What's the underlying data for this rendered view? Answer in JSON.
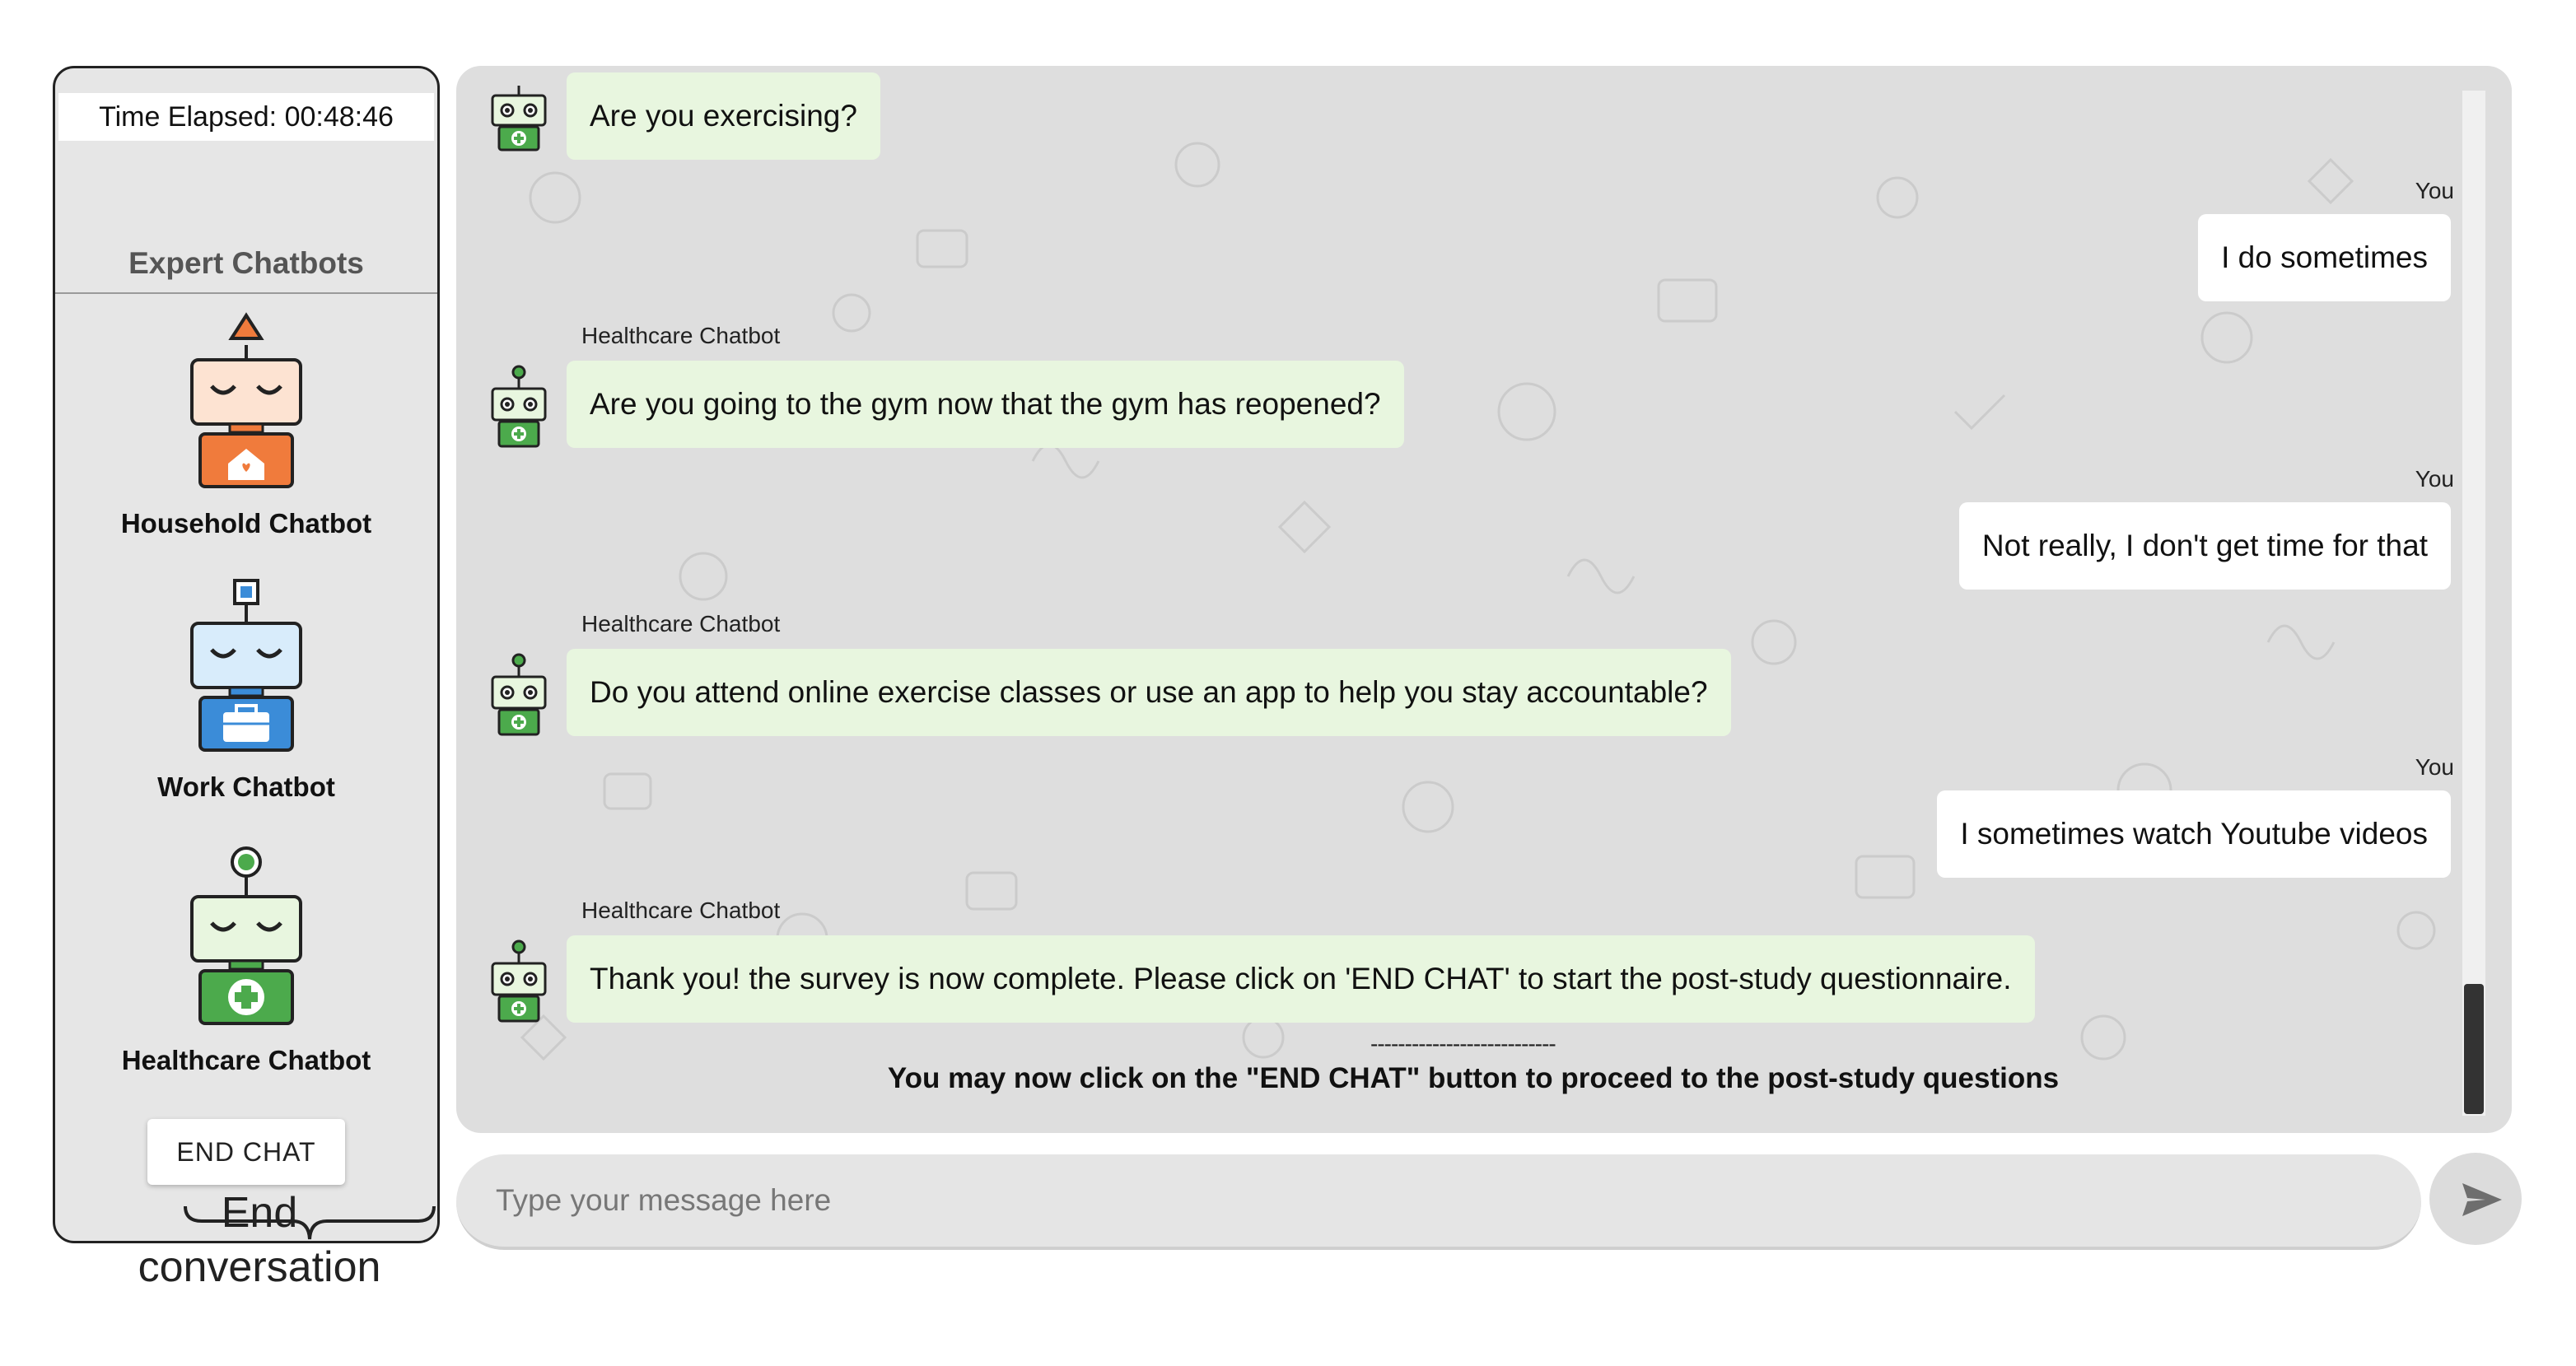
{
  "timer": {
    "label": "Time Elapsed:",
    "value": "00:48:46"
  },
  "sidebar": {
    "title": "Expert Chatbots",
    "bots": [
      {
        "name": "Household Chatbot",
        "icon": "house-icon",
        "color": "#f07b3c"
      },
      {
        "name": "Work Chatbot",
        "icon": "briefcase-icon",
        "color": "#3b8cd8"
      },
      {
        "name": "Healthcare Chatbot",
        "icon": "medical-cross-icon",
        "color": "#4caa4c"
      }
    ],
    "end_chat_label": "END CHAT"
  },
  "annotation": {
    "line1": "End",
    "line2": "conversation"
  },
  "chat": {
    "messages": [
      {
        "from": "bot",
        "sender": "",
        "text": "Are you exercising?"
      },
      {
        "from": "user",
        "sender": "You",
        "text": "I do sometimes"
      },
      {
        "from": "bot",
        "sender": "Healthcare Chatbot",
        "text": "Are you going to the gym now that the gym has reopened?"
      },
      {
        "from": "user",
        "sender": "You",
        "text": "Not really, I don't get time for that"
      },
      {
        "from": "bot",
        "sender": "Healthcare Chatbot",
        "text": "Do you attend online exercise classes or use an app to help you stay accountable?"
      },
      {
        "from": "user",
        "sender": "You",
        "text": "I sometimes watch Youtube videos"
      },
      {
        "from": "bot",
        "sender": "Healthcare Chatbot",
        "text": "Thank you! the survey is now complete. Please click on 'END CHAT' to start the post-study questionnaire."
      }
    ],
    "separator": "---------------------------",
    "final_note": "You may now click on the \"END CHAT\" button to proceed to the post-study questions"
  },
  "input": {
    "placeholder": "Type your message here",
    "value": ""
  },
  "colors": {
    "bot_bubble": "#e8f6df",
    "user_bubble": "#ffffff",
    "chat_bg": "#dedede"
  }
}
